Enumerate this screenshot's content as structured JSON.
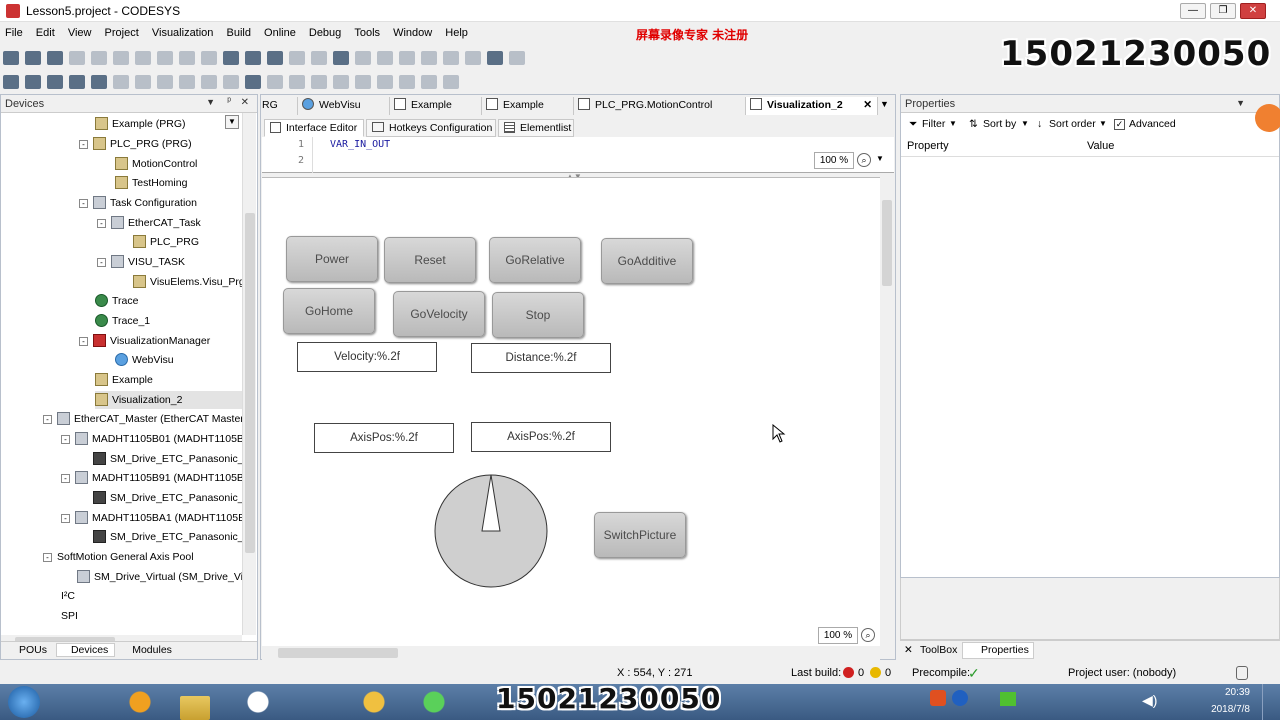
{
  "window": {
    "title": "Lesson5.project - CODESYS",
    "watermark": "屏幕录像专家  未注册",
    "overlay_phone": "15021230050"
  },
  "menu": [
    "File",
    "Edit",
    "View",
    "Project",
    "Visualization",
    "Build",
    "Online",
    "Debug",
    "Tools",
    "Window",
    "Help"
  ],
  "devices_panel": {
    "title": "Devices",
    "tree": [
      {
        "label": "Example (PRG)",
        "icon": "pou"
      },
      {
        "label": "PLC_PRG (PRG)",
        "icon": "pou"
      },
      {
        "label": "MotionControl",
        "icon": "pou"
      },
      {
        "label": "TestHoming",
        "icon": "pou"
      },
      {
        "label": "Task Configuration",
        "icon": "task"
      },
      {
        "label": "EtherCAT_Task",
        "icon": "task"
      },
      {
        "label": "PLC_PRG",
        "icon": "pou"
      },
      {
        "label": "VISU_TASK",
        "icon": "task"
      },
      {
        "label": "VisuElems.Visu_Prg",
        "icon": "pou"
      },
      {
        "label": "Trace",
        "icon": "trace"
      },
      {
        "label": "Trace_1",
        "icon": "trace"
      },
      {
        "label": "VisualizationManager",
        "icon": "visu"
      },
      {
        "label": "WebVisu",
        "icon": "web"
      },
      {
        "label": "Example",
        "icon": "visu"
      },
      {
        "label": "Visualization_2",
        "icon": "visu"
      },
      {
        "label": "EtherCAT_Master (EtherCAT Master)",
        "icon": "device"
      },
      {
        "label": "MADHT1105B01 (MADHT1105B0",
        "icon": "device"
      },
      {
        "label": "SM_Drive_ETC_Panasonic_",
        "icon": "drive"
      },
      {
        "label": "MADHT1105B91 (MADHT1105B9",
        "icon": "device"
      },
      {
        "label": "SM_Drive_ETC_Panasonic_",
        "icon": "drive"
      },
      {
        "label": "MADHT1105BA1 (MADHT1105BA",
        "icon": "device"
      },
      {
        "label": "SM_Drive_ETC_Panasonic_",
        "icon": "drive"
      },
      {
        "label": "SoftMotion General Axis Pool",
        "icon": "device"
      },
      {
        "label": "SM_Drive_Virtual (SM_Drive_Virt",
        "icon": "drive"
      },
      {
        "label": "I²C",
        "icon": "device"
      },
      {
        "label": "SPI",
        "icon": "device"
      }
    ],
    "bottom_tabs": [
      "POUs",
      "Devices",
      "Modules"
    ]
  },
  "editor_tabs": [
    "RG",
    "WebVisu",
    "Example",
    "Example",
    "PLC_PRG.MotionControl",
    "Visualization_2"
  ],
  "sub_tabs": [
    "Interface Editor",
    "Hotkeys Configuration",
    "Elementlist"
  ],
  "code": {
    "line1": "1",
    "line2": "2",
    "text": "VAR_IN_OUT"
  },
  "zoom_top": "100 %",
  "zoom_bottom": "100 %",
  "visu": {
    "buttons": {
      "power": "Power",
      "reset": "Reset",
      "gorelative": "GoRelative",
      "goadditive": "GoAdditive",
      "gohome": "GoHome",
      "govelocity": "GoVelocity",
      "stop": "Stop",
      "switchpicture": "SwitchPicture"
    },
    "fields": {
      "velocity": "Velocity:%.2f",
      "distance": "Distance:%.2f",
      "axispos1": "AxisPos:%.2f",
      "axispos2": "AxisPos:%.2f"
    }
  },
  "properties_panel": {
    "title": "Properties",
    "filter": "Filter",
    "sort_by": "Sort by",
    "sort_order": "Sort order",
    "advanced": "Advanced",
    "col_property": "Property",
    "col_value": "Value",
    "bottom_tabs": [
      "ToolBox",
      "Properties"
    ]
  },
  "status": {
    "coords": "X : 554, Y : 271",
    "last_build": "Last build:",
    "errors": "0",
    "warnings": "0",
    "precompile": "Precompile:",
    "user": "Project user: (nobody)"
  },
  "taskbar": {
    "time": "20:39",
    "date": "2018/7/8"
  },
  "colors": {
    "accent": "#316ac5",
    "watermark": "#e00000",
    "button_gray": "#c8c8c8"
  }
}
